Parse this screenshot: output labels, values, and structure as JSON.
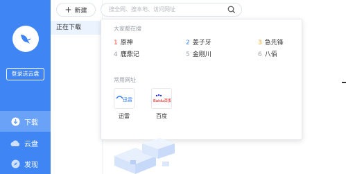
{
  "sidebar": {
    "login_label": "登录送云盘",
    "nav": [
      {
        "label": "下载",
        "icon": "download-icon",
        "active": true
      },
      {
        "label": "云盘",
        "icon": "cloud-icon",
        "active": false
      },
      {
        "label": "发现",
        "icon": "discover-icon",
        "active": false
      }
    ]
  },
  "toolbar": {
    "new_label": "新建",
    "search_placeholder": "搜全网、搜本地、访问网址"
  },
  "list": {
    "items": [
      "正在下载"
    ]
  },
  "dropdown": {
    "hot_title": "大家都在搜",
    "hot": [
      {
        "num": "1",
        "text": "原神"
      },
      {
        "num": "2",
        "text": "姜子牙"
      },
      {
        "num": "3",
        "text": "急先锋"
      },
      {
        "num": "4",
        "text": "鹿鼎记"
      },
      {
        "num": "5",
        "text": "金刚川"
      },
      {
        "num": "6",
        "text": "八佰"
      }
    ],
    "sites_title": "常用网址",
    "sites": [
      {
        "name": "迅雷",
        "logo_text": "迅雷"
      },
      {
        "name": "百度",
        "logo_text": "Baidu百度"
      }
    ]
  },
  "colors": {
    "accent": "#3f86f4",
    "rank1": "#f2463f",
    "rank2": "#3f86f4",
    "rank3": "#f5a623",
    "rank_rest": "#9aa0a8"
  }
}
